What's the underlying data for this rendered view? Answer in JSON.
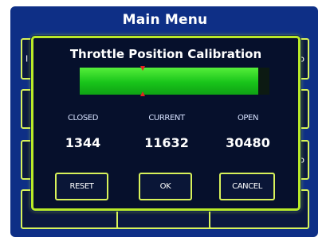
{
  "main_menu": {
    "title": "Main Menu",
    "edge_left": "I",
    "edge_right_top": "o",
    "edge_right_mid": "o"
  },
  "dialog": {
    "title": "Throttle Position Calibration",
    "bar": {
      "min": 1344,
      "current": 11632,
      "max": 30480,
      "fill_fraction": 0.94,
      "marker_fraction": 0.33,
      "fill_color": "#22cc22",
      "marker_color": "#e52222"
    },
    "columns": {
      "closed_label": "CLOSED",
      "current_label": "CURRENT",
      "open_label": "OPEN",
      "closed_value": "1344",
      "current_value": "11632",
      "open_value": "30480"
    },
    "buttons": {
      "reset": "RESET",
      "ok": "OK",
      "cancel": "CANCEL"
    }
  },
  "colors": {
    "background": "#0e2f86",
    "accent": "#c6ec2a",
    "panel": "#06102c"
  }
}
